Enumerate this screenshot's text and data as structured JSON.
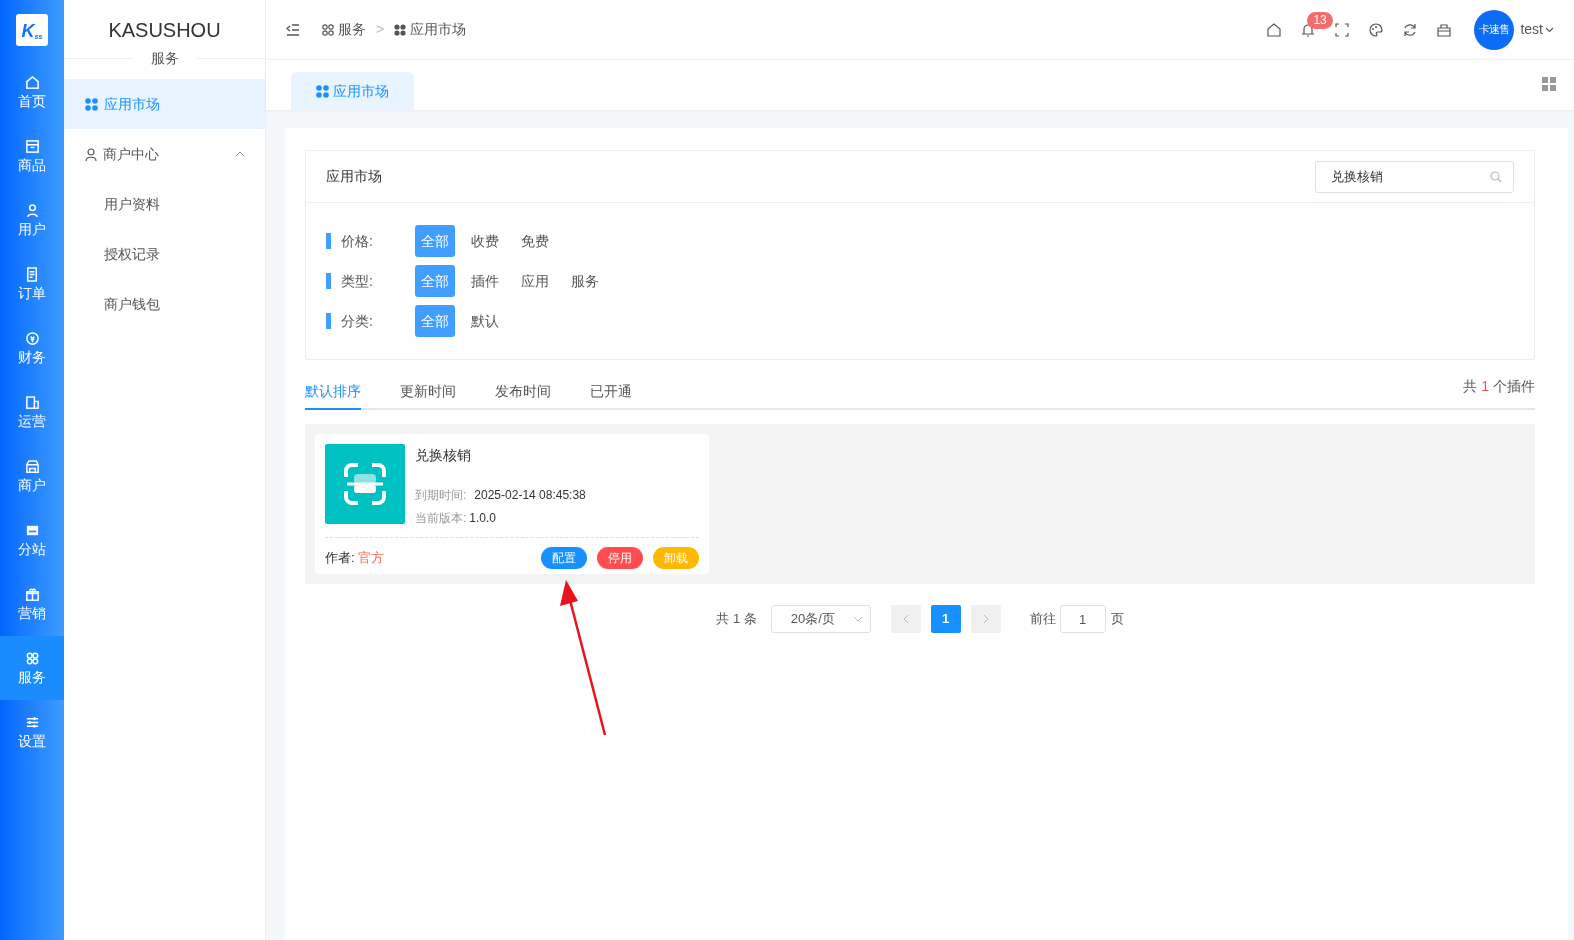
{
  "rail": {
    "logo": "K",
    "logo_sub": "ss",
    "items": [
      {
        "label": "首页",
        "selected": false
      },
      {
        "label": "商品",
        "selected": false
      },
      {
        "label": "用户",
        "selected": false
      },
      {
        "label": "订单",
        "selected": false
      },
      {
        "label": "财务",
        "selected": false
      },
      {
        "label": "运营",
        "selected": false
      },
      {
        "label": "商户",
        "selected": false
      },
      {
        "label": "分站",
        "selected": false
      },
      {
        "label": "营销",
        "selected": false
      },
      {
        "label": "服务",
        "selected": true
      },
      {
        "label": "设置",
        "selected": false
      }
    ]
  },
  "sidebar": {
    "brand": "KASUSHOU",
    "section": "服务",
    "items": [
      {
        "label": "应用市场",
        "selected": true
      },
      {
        "label": "商户中心",
        "selected": false,
        "expanded": true,
        "children": [
          {
            "label": "用户资料",
            "selected": false
          },
          {
            "label": "授权记录",
            "selected": false
          },
          {
            "label": "商户钱包",
            "selected": false
          }
        ]
      }
    ]
  },
  "header": {
    "breadcrumb": [
      "服务",
      "应用市场"
    ],
    "separator": ">",
    "notification_count": "13",
    "avatar_text": "卡速售",
    "user": "test"
  },
  "tabs": [
    {
      "label": "应用市场",
      "selected": true
    }
  ],
  "panel": {
    "title": "应用市场",
    "search": {
      "value": "兑换核销"
    },
    "filters": [
      {
        "label": "价格:",
        "options": [
          {
            "label": "全部",
            "selected": true
          },
          {
            "label": "收费",
            "selected": false
          },
          {
            "label": "免费",
            "selected": false
          }
        ]
      },
      {
        "label": "类型:",
        "options": [
          {
            "label": "全部",
            "selected": true
          },
          {
            "label": "插件",
            "selected": false
          },
          {
            "label": "应用",
            "selected": false
          },
          {
            "label": "服务",
            "selected": false
          }
        ]
      },
      {
        "label": "分类:",
        "options": [
          {
            "label": "全部",
            "selected": true
          },
          {
            "label": "默认",
            "selected": false
          }
        ]
      }
    ]
  },
  "sort_tabs": [
    {
      "label": "默认排序",
      "selected": true
    },
    {
      "label": "更新时间",
      "selected": false
    },
    {
      "label": "发布时间",
      "selected": false
    },
    {
      "label": "已开通",
      "selected": false
    }
  ],
  "count": {
    "prefix": "共",
    "value": "1",
    "suffix": "个插件"
  },
  "plugins": [
    {
      "name": "兑换核销",
      "expiry_label": "到期时间:",
      "expiry": "2025-02-14 08:45:38",
      "version_label": "当前版本:",
      "version": "1.0.0",
      "author_label": "作者:",
      "author": "官方",
      "actions": [
        {
          "label": "配置",
          "color": "#1890ff"
        },
        {
          "label": "停用",
          "color": "#ff4d4f"
        },
        {
          "label": "卸载",
          "color": "#ffb800"
        }
      ]
    }
  ],
  "pagination": {
    "total": "共 1 条",
    "page_size": "20条/页",
    "pages": [
      {
        "label": "1",
        "selected": true
      }
    ],
    "goto_label": "前往",
    "goto_value": "1",
    "goto_suffix": "页"
  }
}
